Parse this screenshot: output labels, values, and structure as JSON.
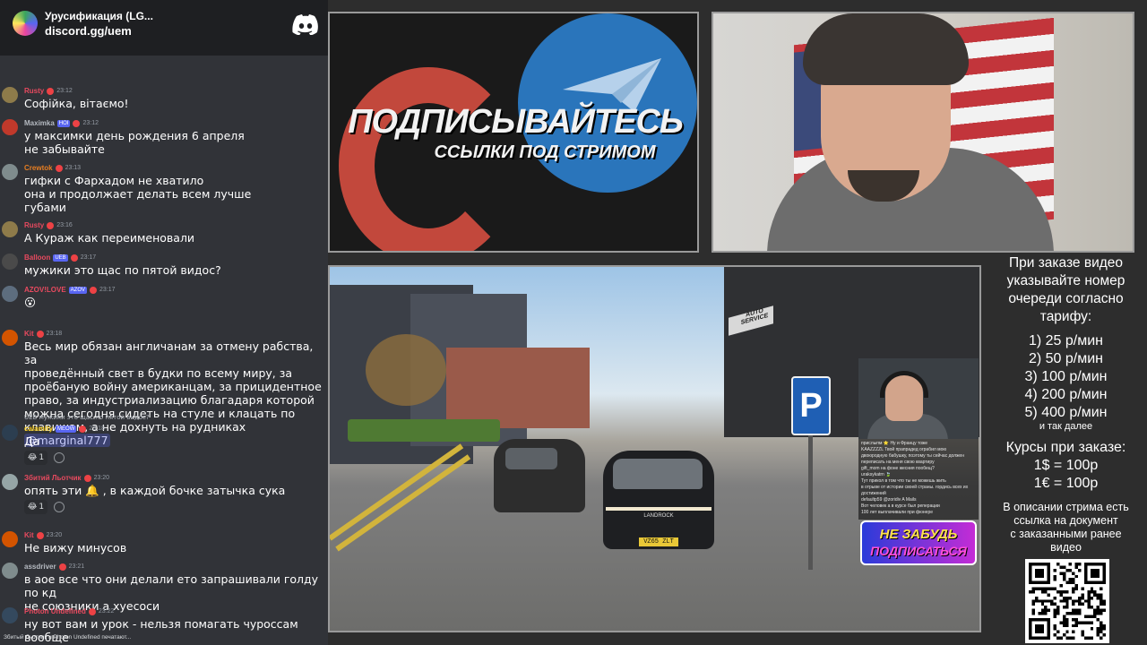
{
  "discord": {
    "server_name": "Урусификация (LG...",
    "server_link": "discord.gg/uem",
    "typing": "Збитый Льотчик и Photon Undefined печатают..."
  },
  "messages": [
    {
      "nick": "Rusty",
      "color": "#e84a5f",
      "time": "23:12",
      "badge": "",
      "avatar": "#8e7b4a",
      "lines": [
        "Софійка, вітаємо!"
      ]
    },
    {
      "nick": "Maximka",
      "color": "#b5bac1",
      "time": "23:12",
      "badge": "HOI",
      "avatar": "#c0392b",
      "lines": [
        "у максимки день рождения 6 апреля",
        "не забывайте"
      ]
    },
    {
      "nick": "Crewtok",
      "color": "#e67e22",
      "time": "23:13",
      "badge": "",
      "avatar": "#7f8c8d",
      "lines": [
        "гифки с Фархадом не хватило",
        "она и продолжает делать всем лучше",
        "губами"
      ]
    },
    {
      "nick": "Rusty",
      "color": "#e84a5f",
      "time": "23:16",
      "badge": "",
      "avatar": "#8e7b4a",
      "lines": [
        "А Кураж как переименовали"
      ]
    },
    {
      "nick": "Balloon",
      "color": "#e84a5f",
      "time": "23:17",
      "badge": "UEB",
      "avatar": "#4a4a4a",
      "lines": [
        "мужики это щас по пятой видос?"
      ]
    },
    {
      "nick": "AZOV!LOVE",
      "color": "#e84a5f",
      "time": "23:17",
      "badge": "AZOV",
      "avatar": "#5d6d7e",
      "lines": [
        "😮"
      ]
    },
    {
      "nick": "Kit",
      "color": "#e84a5f",
      "time": "23:18",
      "badge": "",
      "avatar": "#d35400",
      "lines": [
        "Весь мир обязан англичанам за отмену рабства, за",
        "проведённый свет в будки по всему миру, за",
        "проёбаную войну американцам, за прицидентное",
        "право, за индустриализацию благадаря которой",
        "можна сегодня сидеть на стуле и клацать по",
        "клавишам, а не дохнуть на рудниках"
      ],
      "mention": "@marginal777"
    },
    {
      "nick": "calamity",
      "color": "#f1c40f",
      "time": "23:18",
      "badge": "MEOW",
      "avatar": "#2c3e50",
      "reply": "UEB мужики это щас по пятой видос?",
      "lines": [
        "Да"
      ],
      "reaction": "1"
    },
    {
      "nick": "Збитий Льотчик",
      "color": "#e84a5f",
      "time": "23:20",
      "badge": "",
      "avatar": "#95a5a6",
      "lines": [
        "опять эти 🔔 , в каждой бочке затычка сука"
      ],
      "reaction": "1"
    },
    {
      "nick": "Kit",
      "color": "#e84a5f",
      "time": "23:20",
      "badge": "",
      "avatar": "#d35400",
      "lines": [
        "Не вижу минусов"
      ]
    },
    {
      "nick": "assdriver",
      "color": "#b5bac1",
      "time": "23:21",
      "badge": "",
      "avatar": "#7f8c8d",
      "lines": [
        "в аое все что они делали ето запрашивали голду по кд",
        "не союзники а хуесоси"
      ]
    },
    {
      "nick": "Photon Undefined",
      "color": "#e84a5f",
      "time": "23:22",
      "badge": "",
      "avatar": "#34495e",
      "lines": [
        "ну вот вам и урок - нельзя помагать чуроссам вообще"
      ]
    }
  ],
  "banner": {
    "title": "ПОДПИСЫВАЙТЕСЬ",
    "subtitle": "ССЫЛКИ ПОД СТРИМОМ"
  },
  "game": {
    "auto_service": "AUTO SERVICE",
    "parking": "P",
    "car_brand": "LANDROCK",
    "plate": "VZ65 ZLT",
    "reminder_line1": "НЕ ЗАБУДЬ",
    "reminder_line2": "ПОДПИСАТЬСЯ",
    "inner_chat": [
      "прислыпм ⭐ Ну и Францу тоже",
      "KAAZZZZL Твой прапрадед ограбил мою",
      "двоюродную бабушку, поэтому ты сейчас должен",
      "переписать на меня свою квартиру",
      "gift_mom на фоне жесния пообещ?",
      "uraksykatrn 🍃",
      "Тут прикол в том что ты не можешь жить",
      "в отрыве от истории своей страны. гордись всех их",
      "достижений",
      "defaultp59 @zoridiv A Mails",
      "Вот человек а в курсе был реперации",
      "100 лет выплачивали при фюнере"
    ]
  },
  "panel": {
    "intro": [
      "При заказе видео",
      "указывайте номер",
      "очереди согласно",
      "тарифу:"
    ],
    "prices": [
      "1) 25 р/мин",
      "2) 50 р/мин",
      "3) 100 р/мин",
      "4) 200 р/мин",
      "5) 400 р/мин"
    ],
    "etc": "и так далее",
    "rates_title": "Курсы при заказе:",
    "rates": [
      "1$ = 100р",
      "1€ = 100р"
    ],
    "note": [
      "В описании стрима есть",
      "ссылка на документ",
      "с заказанными ранее",
      "видео"
    ]
  }
}
